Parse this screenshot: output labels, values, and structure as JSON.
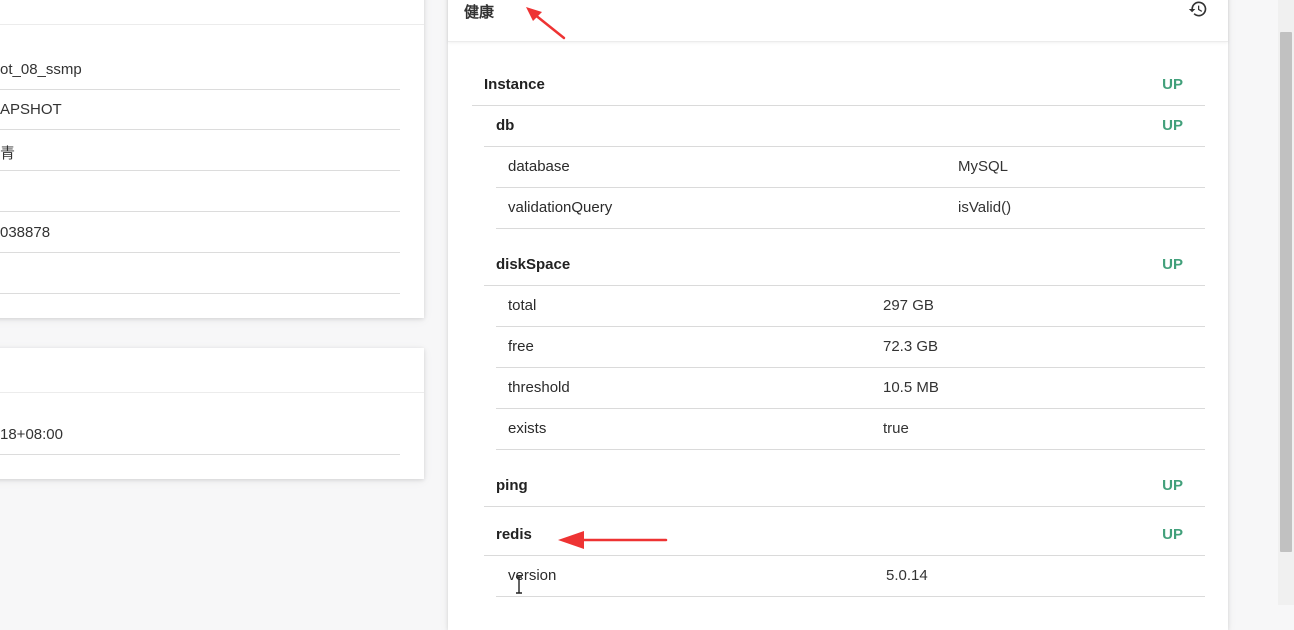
{
  "info_card": {
    "rows": [
      "ot_08_ssmp",
      "APSHOT",
      "青",
      "",
      "038878",
      ""
    ]
  },
  "start_card": {
    "rows": [
      "18+08:00"
    ]
  },
  "health": {
    "title": "健康",
    "history_icon": "history-icon",
    "status_color": "#42a07b",
    "instance": {
      "label": "Instance",
      "status": "UP"
    },
    "components": {
      "db": {
        "label": "db",
        "status": "UP",
        "details": [
          {
            "key": "database",
            "value": "MySQL"
          },
          {
            "key": "validationQuery",
            "value": "isValid()"
          }
        ]
      },
      "diskSpace": {
        "label": "diskSpace",
        "status": "UP",
        "details": [
          {
            "key": "total",
            "value": "297 GB"
          },
          {
            "key": "free",
            "value": "72.3 GB"
          },
          {
            "key": "threshold",
            "value": "10.5 MB"
          },
          {
            "key": "exists",
            "value": "true"
          }
        ]
      },
      "ping": {
        "label": "ping",
        "status": "UP"
      },
      "redis": {
        "label": "redis",
        "status": "UP",
        "details": [
          {
            "key": "version",
            "value": "5.0.14"
          }
        ]
      }
    }
  },
  "annotation_color": "#ee3333"
}
